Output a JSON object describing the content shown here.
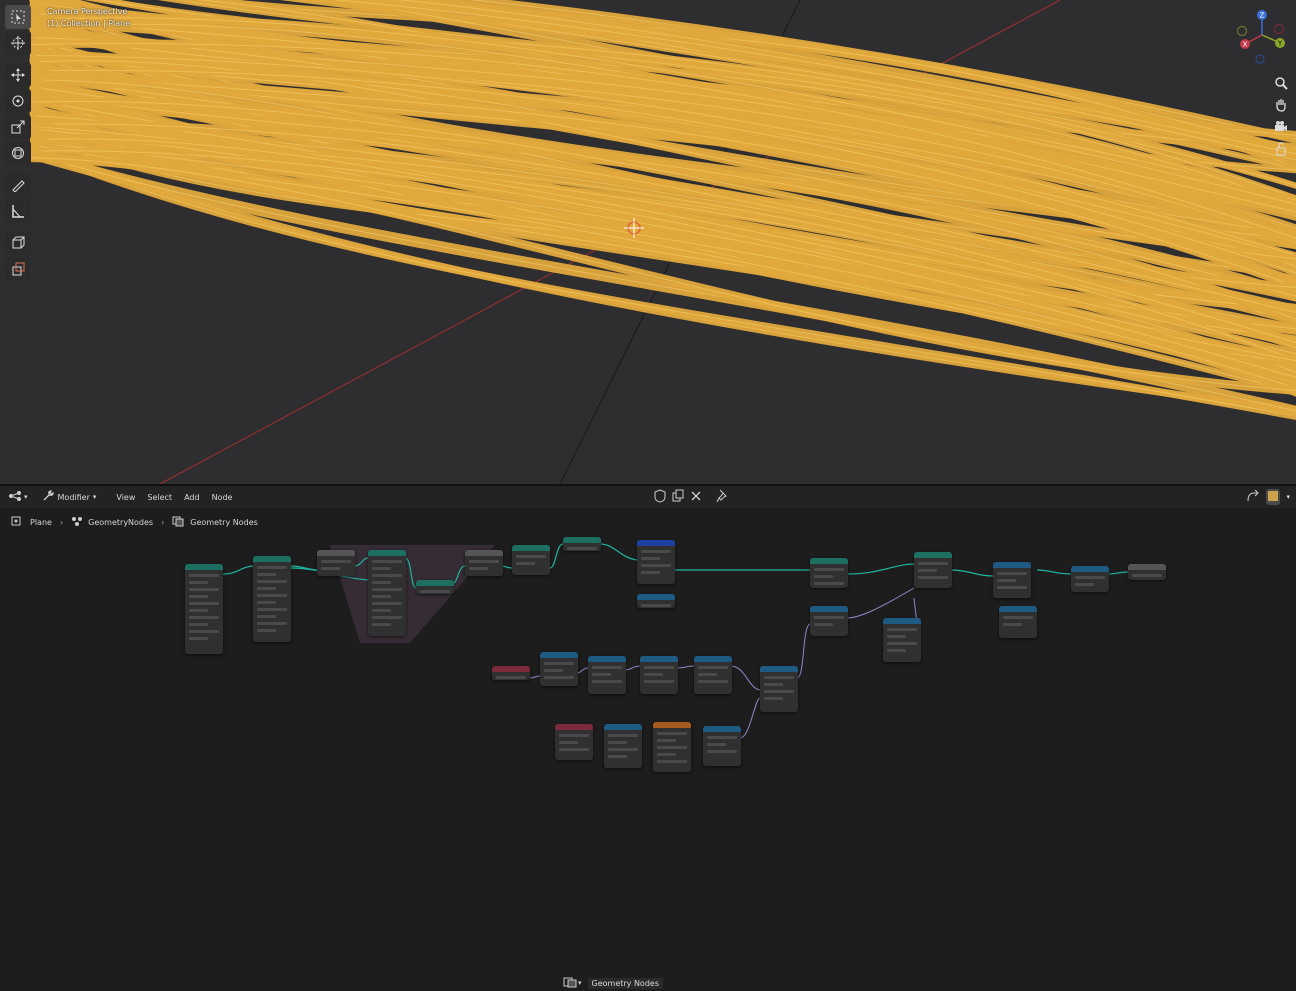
{
  "viewport": {
    "camera_label": "Camera Perspective",
    "collection_label": "(1) Collection | Plane",
    "strand_color": "#e0a83c",
    "background_color": "#303030"
  },
  "gizmo": {
    "z": "Z",
    "x": "X",
    "y": "Y"
  },
  "toolbar": {
    "tools": [
      "select-box-icon",
      "cursor-icon",
      "move-icon",
      "rotate-icon",
      "scale-icon",
      "transform-icon",
      "annotate-icon",
      "measure-icon",
      "add-cube-icon",
      "extrude-icon"
    ]
  },
  "nav_icons": [
    "zoom-icon",
    "hand-pan-icon",
    "camera-view-icon",
    "lock-icon"
  ],
  "node_editor": {
    "editor_type_icon": "node-editor-icon",
    "mode_label": "Modifier",
    "menus": [
      "View",
      "Select",
      "Add",
      "Node"
    ],
    "tree_name": "Geometry Nodes",
    "breadcrumb": [
      "Plane",
      "GeometryNodes",
      "Geometry Nodes"
    ]
  },
  "node_colors": {
    "geometry": "#1d6f62",
    "input": "#7a2a3a",
    "converter": "#1f5a82",
    "vector": "#1e3fa0",
    "group": "#a35a1a",
    "link": "#1fb5a0"
  }
}
